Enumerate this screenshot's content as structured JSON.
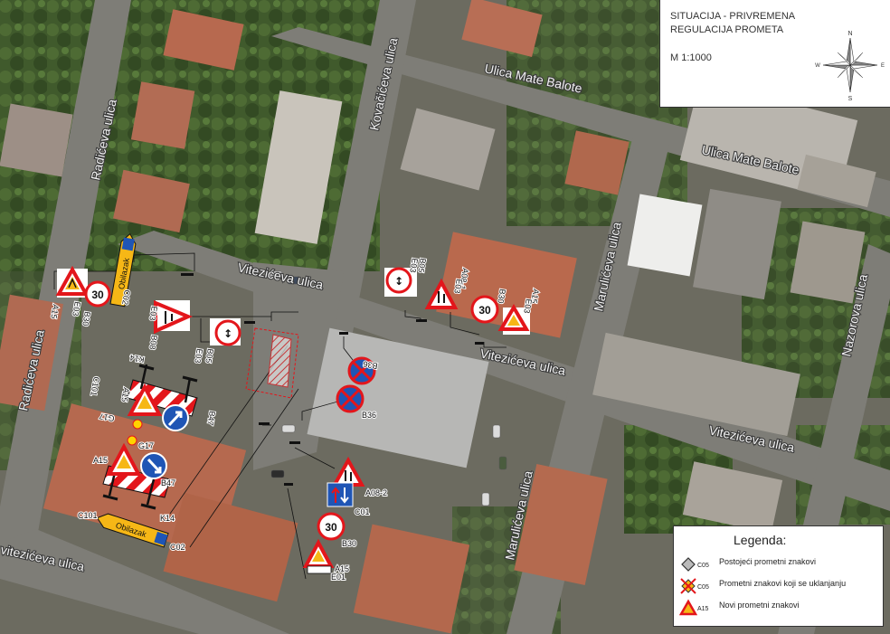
{
  "title": {
    "line1": "SITUACIJA - PRIVREMENA",
    "line2": "REGULACIJA PROMETA",
    "scale": "M 1:1000"
  },
  "compass": {
    "n": "N",
    "s": "S",
    "e": "E",
    "w": "W"
  },
  "streets": {
    "mate_balote_1": "Ulica Mate Balote",
    "mate_balote_2": "Ulica Mate Balote",
    "kovaciceva": "Kovačićeva ulica",
    "radiceva_1": "Radićeva ulica",
    "radiceva_2": "Radićeva ulica",
    "viteziceva_1": "Vitezićeva ulica",
    "viteziceva_2": "Vitezićeva ulica",
    "viteziceva_3": "Vitezićeva ulica",
    "viteziceva_4": "vitezićeva ulica",
    "maruliceva_1": "Marulićeva ulica",
    "maruliceva_2": "Marulićeva ulica",
    "nazorova": "Nazorova ulica"
  },
  "sign_codes": {
    "E03_a": "E03",
    "B30_a": "B30",
    "A15_a": "A15",
    "C02_a": "C02",
    "B08_a": "B08",
    "E03_b": "E03",
    "B05_a": "B05",
    "E03_c": "E03",
    "B05_b": "B05",
    "E03_d": "E03",
    "A08_1": "A08-1",
    "E03_e": "E03",
    "B30_b": "B30",
    "A15_b": "A15",
    "E03_f": "E03",
    "B36_a": "B36",
    "B36_b": "B36",
    "C101_a": "C101",
    "K14_a": "K14",
    "A15_c": "A15",
    "G17_a": "G17",
    "B47_a": "B47",
    "G17_b": "G17",
    "A15_d": "A15",
    "B47_b": "B47",
    "K14_b": "K14",
    "C101_b": "C101",
    "C02_b": "C02",
    "A08_2": "A08-2",
    "C01": "C01",
    "B30_c": "B30",
    "A15_e": "A15",
    "E01": "E01",
    "speed": "30",
    "obilazak": "Obilazak"
  },
  "legend": {
    "title": "Legenda:",
    "rows": [
      {
        "code": "C05",
        "text": "Postojeći prometni znakovi"
      },
      {
        "code": "C05",
        "text": "Prometni znakovi koji se uklanjanju"
      },
      {
        "code": "A15",
        "text": "Novi prometni znakovi"
      }
    ]
  },
  "colors": {
    "sign_red": "#e3161b",
    "sign_blue": "#1f55b5",
    "obilazak_yellow": "#f6b716",
    "roof_tile": "#b7694f",
    "road": "#7b7b76",
    "vegetation": "#3e5a2a"
  }
}
